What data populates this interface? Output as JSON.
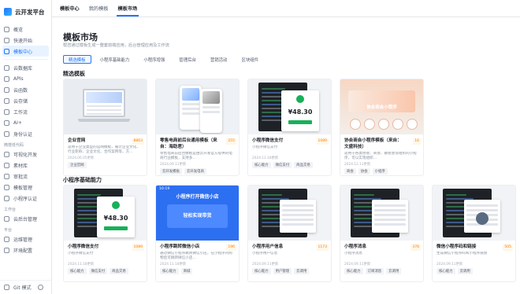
{
  "app": {
    "brand": "云开发平台"
  },
  "sidebar": {
    "items": [
      {
        "label": "概览"
      },
      {
        "label": "快速开始"
      },
      {
        "label": "模板中心",
        "active": true
      }
    ],
    "section2": [
      {
        "label": "云数据库"
      },
      {
        "label": "APIs"
      },
      {
        "label": "云函数"
      },
      {
        "label": "云存储"
      },
      {
        "label": "工作流"
      },
      {
        "label": "AI+"
      },
      {
        "label": "身份认证"
      }
    ],
    "sec_lowcode": "微搭低代码",
    "section3": [
      {
        "label": "可视化开发"
      },
      {
        "label": "素材库"
      },
      {
        "label": "审批流"
      },
      {
        "label": "模板管理"
      },
      {
        "label": "小程序认证"
      }
    ],
    "sec_workbench": "工作台",
    "section4": [
      {
        "label": "云后台管理"
      }
    ],
    "sec_ops": "平台",
    "section5": [
      {
        "label": "运维管理"
      },
      {
        "label": "环境配置"
      }
    ],
    "footer": {
      "label": "Git 模式"
    }
  },
  "topbar": {
    "tabs": [
      "模板中心",
      "我的模板",
      "模板市场"
    ]
  },
  "page": {
    "title": "模板市场",
    "subtitle": "帮您通过模板生成一整套前端应用，后台管理应用及工作流",
    "filters": [
      "精选模板",
      "小程序基础能力",
      "小程序增强",
      "管理后台",
      "营销活动",
      "区块组件"
    ],
    "section_featured": "精选模板",
    "section_basic": "小程序基础能力"
  },
  "featured": [
    {
      "title": "企业官网",
      "count": "8863",
      "desc": "适用于企业类型的官网模板，展示企业文化、行业影响、企业文化、合作案例等，方…",
      "date": "2024.06.05更新",
      "tags": [
        "企业官网"
      ],
      "thumb": "site"
    },
    {
      "title": "零售电商前后台通用模板（来自：海助君）",
      "count": "255",
      "desc": "零售电商前后台模板是由云开发官方提供的电商行业模板，支持多…",
      "date": "2024.09.11更新",
      "tags": [
        "云开发模板",
        "云开发电商"
      ],
      "thumb": "shop"
    },
    {
      "title": "小程序微信支付",
      "count": "1089",
      "desc": "小程序微信支付",
      "date": "2024.11.18更新",
      "tags": [
        "核心能力",
        "微信支付",
        "商品交易"
      ],
      "thumb": "pay",
      "amount": "¥48.30"
    },
    {
      "title": "协会商会小程序模板（来自：文盛科技）",
      "count": "16",
      "desc": "适用于各类协会、商会、群组会等组织的小程序，可以实现组织…",
      "date": "2024.12.11更新",
      "tags": [
        "商会",
        "协会",
        "小程序"
      ],
      "thumb": "assoc",
      "org": "协会商会小程序"
    }
  ],
  "basic": [
    {
      "title": "小程序微信支付",
      "count": "1089",
      "desc": "小程序微信支付",
      "date": "2024.11.18更新",
      "tags": [
        "核心能力",
        "微信支付",
        "商品交易"
      ],
      "thumb": "pay",
      "amount": "¥48.30"
    },
    {
      "title": "小程序跳转微信小店",
      "count": "196",
      "desc": "通过微信小程序跳转微信小店，在小程序内购物后可跳转微信小店…",
      "date": "2024.11.18更新",
      "tags": [
        "核心能力",
        "商城"
      ],
      "thumb": "store",
      "headline": "小程序打开微信小店",
      "inner": "轻松实现带货"
    },
    {
      "title": "小程序用户信息",
      "count": "1173",
      "desc": "小程序用户信息",
      "date": "2024.09.11更新",
      "tags": [
        "核心能力",
        "用户管理",
        "云调用"
      ],
      "thumb": "user"
    },
    {
      "title": "小程序消息",
      "count": "378",
      "desc": "小程序消息",
      "date": "2024.09.11更新",
      "tags": [
        "核心能力",
        "订阅消息",
        "云调用"
      ],
      "thumb": "msg"
    },
    {
      "title": "微信小程序码和链接",
      "count": "505",
      "desc": "生成微信小程序码和小程序链接",
      "date": "2024.09.11更新",
      "tags": [
        "核心能力",
        "云调用"
      ],
      "thumb": "code"
    }
  ]
}
